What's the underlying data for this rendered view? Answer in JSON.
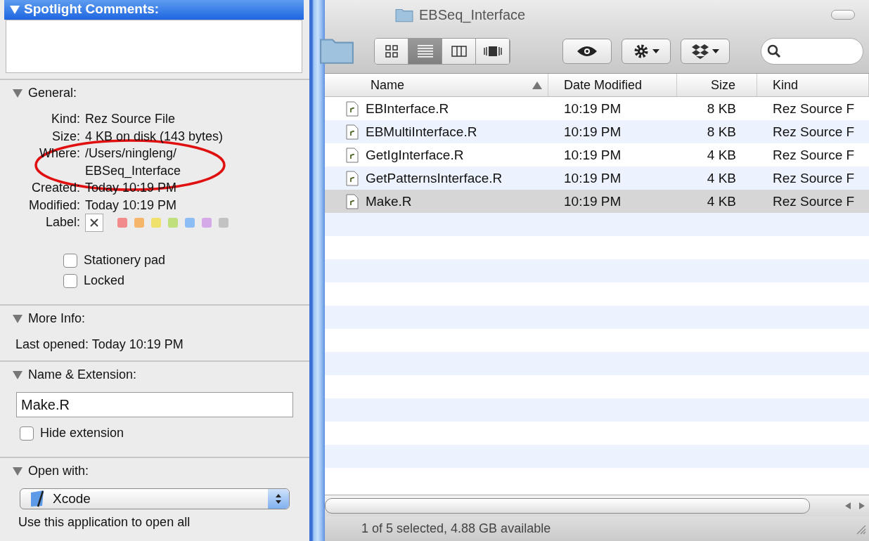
{
  "info_panel": {
    "spotlight": {
      "title": "Spotlight Comments:",
      "expanded": true
    },
    "general": {
      "title": "General:",
      "expanded": true,
      "fields": [
        {
          "label": "Kind:",
          "value": "Rez Source File"
        },
        {
          "label": "Size:",
          "value": "4 KB on disk (143 bytes)"
        },
        {
          "label": "Where:",
          "value": "/Users/ningleng/ EBSeq_Interface"
        },
        {
          "label": "Created:",
          "value": "Today 10:19 PM"
        },
        {
          "label": "Modified:",
          "value": "Today 10:19 PM"
        }
      ],
      "label_title": "Label:",
      "labels": [
        {
          "kind": "none"
        },
        {
          "kind": "color",
          "color": "#f28c8c"
        },
        {
          "kind": "color",
          "color": "#f5b66c"
        },
        {
          "kind": "color",
          "color": "#efe16c"
        },
        {
          "kind": "color",
          "color": "#bfe07c"
        },
        {
          "kind": "color",
          "color": "#8dbdf5"
        },
        {
          "kind": "color",
          "color": "#d5a9e8"
        },
        {
          "kind": "color",
          "color": "#c2c2c2"
        }
      ],
      "checkboxes": [
        {
          "label": "Stationery pad",
          "checked": false
        },
        {
          "label": "Locked",
          "checked": false
        }
      ]
    },
    "more_info": {
      "title": "More Info:",
      "expanded": true,
      "last_opened": "Last opened: Today 10:19 PM"
    },
    "name_extension": {
      "title": "Name & Extension:",
      "expanded": true,
      "value": "Make.R",
      "hide_extension": {
        "label": "Hide extension",
        "checked": false
      }
    },
    "open_with": {
      "title": "Open with:",
      "expanded": true,
      "app": "Xcode",
      "note": "Use this application to open all"
    }
  },
  "finder": {
    "title": "EBSeq_Interface",
    "views": [
      {
        "kind": "icons",
        "selected": false
      },
      {
        "kind": "list",
        "selected": true
      },
      {
        "kind": "columns",
        "selected": false
      },
      {
        "kind": "coverflow",
        "selected": false
      }
    ],
    "columns": [
      {
        "label": "Name",
        "sorted": true
      },
      {
        "label": "Date Modified",
        "sorted": false
      },
      {
        "label": "Size",
        "sorted": false
      },
      {
        "label": "Kind",
        "sorted": false
      }
    ],
    "rows": [
      {
        "name": "EBInterface.R",
        "date": "10:19 PM",
        "size": "8 KB",
        "kind": "Rez Source F",
        "selected": false
      },
      {
        "name": "EBMultiInterface.R",
        "date": "10:19 PM",
        "size": "8 KB",
        "kind": "Rez Source F",
        "selected": false
      },
      {
        "name": "GetIgInterface.R",
        "date": "10:19 PM",
        "size": "4 KB",
        "kind": "Rez Source F",
        "selected": false
      },
      {
        "name": "GetPatternsInterface.R",
        "date": "10:19 PM",
        "size": "4 KB",
        "kind": "Rez Source F",
        "selected": false
      },
      {
        "name": "Make.R",
        "date": "10:19 PM",
        "size": "4 KB",
        "kind": "Rez Source F",
        "selected": true
      }
    ],
    "status_bar": "1 of 5 selected, 4.88 GB available"
  }
}
